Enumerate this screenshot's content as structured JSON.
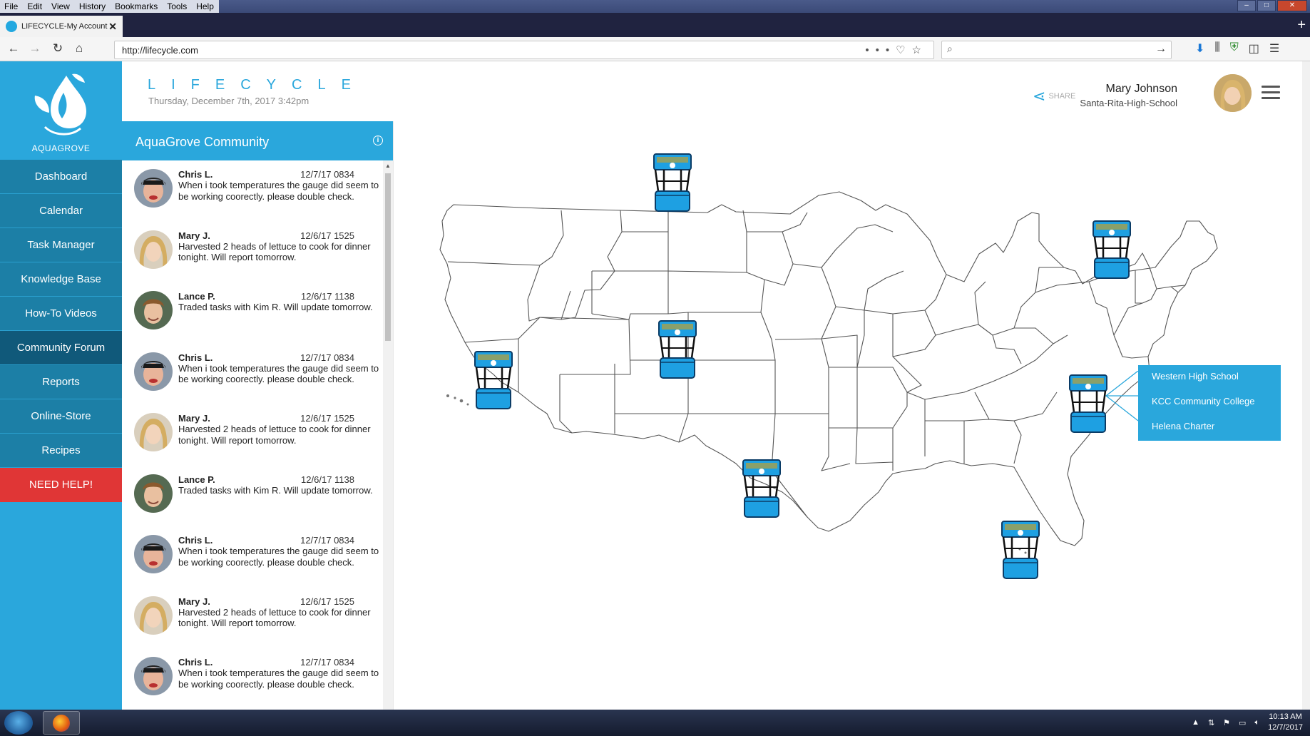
{
  "browser": {
    "menu": [
      "File",
      "Edit",
      "View",
      "History",
      "Bookmarks",
      "Tools",
      "Help"
    ],
    "tab_title": "LIFECYCLE-My Account",
    "url": "http://lifecycle.com"
  },
  "app": {
    "title": "LIFECYCLE",
    "datetime": "Thursday, December 7th, 2017  3:42pm",
    "brand": "AQUAGROVE",
    "share_label": "SHARE",
    "user": {
      "name": "Mary Johnson",
      "school": "Santa-Rita-High-School"
    }
  },
  "sidebar": {
    "items": [
      {
        "label": "Dashboard"
      },
      {
        "label": "Calendar"
      },
      {
        "label": "Task Manager"
      },
      {
        "label": "Knowledge Base"
      },
      {
        "label": "How-To Videos"
      },
      {
        "label": "Community Forum"
      },
      {
        "label": "Reports"
      },
      {
        "label": "Online-Store"
      },
      {
        "label": "Recipes"
      },
      {
        "label": "NEED HELP!"
      }
    ]
  },
  "community": {
    "title": "AquaGrove Community",
    "posts": [
      {
        "name": "Chris L.",
        "date": "12/7/17 0834",
        "msg": "When i took temperatures the gauge did seem to be working coorectly.  please double check."
      },
      {
        "name": "Mary J.",
        "date": "12/6/17 1525",
        "msg": "Harvested 2 heads of lettuce to cook for dinner tonight.  Will report tomorrow."
      },
      {
        "name": "Lance P.",
        "date": "12/6/17 1138",
        "msg": "Traded tasks with Kim R.  Will update tomorrow."
      },
      {
        "name": "Chris L.",
        "date": "12/7/17 0834",
        "msg": "When i took temperatures the gauge did seem to be working coorectly.  please double check."
      },
      {
        "name": "Mary J.",
        "date": "12/6/17 1525",
        "msg": "Harvested 2 heads of lettuce to cook for dinner tonight.  Will report tomorrow."
      },
      {
        "name": "Lance P.",
        "date": "12/6/17 1138",
        "msg": "Traded tasks with Kim R.  Will update tomorrow."
      },
      {
        "name": "Chris L.",
        "date": "12/7/17 0834",
        "msg": "When i took temperatures the gauge did seem to be working coorectly.  please double check."
      },
      {
        "name": "Mary J.",
        "date": "12/6/17 1525",
        "msg": "Harvested 2 heads of lettuce to cook for dinner tonight.  Will report tomorrow."
      },
      {
        "name": "Chris L.",
        "date": "12/7/17 0834",
        "msg": "When i took temperatures the gauge did seem to be working coorectly.  please double check."
      }
    ]
  },
  "map": {
    "popup": [
      "Western High School",
      "KCC Community College",
      "Helena Charter"
    ]
  },
  "taskbar": {
    "time": "10:13 AM",
    "date": "12/7/2017"
  }
}
